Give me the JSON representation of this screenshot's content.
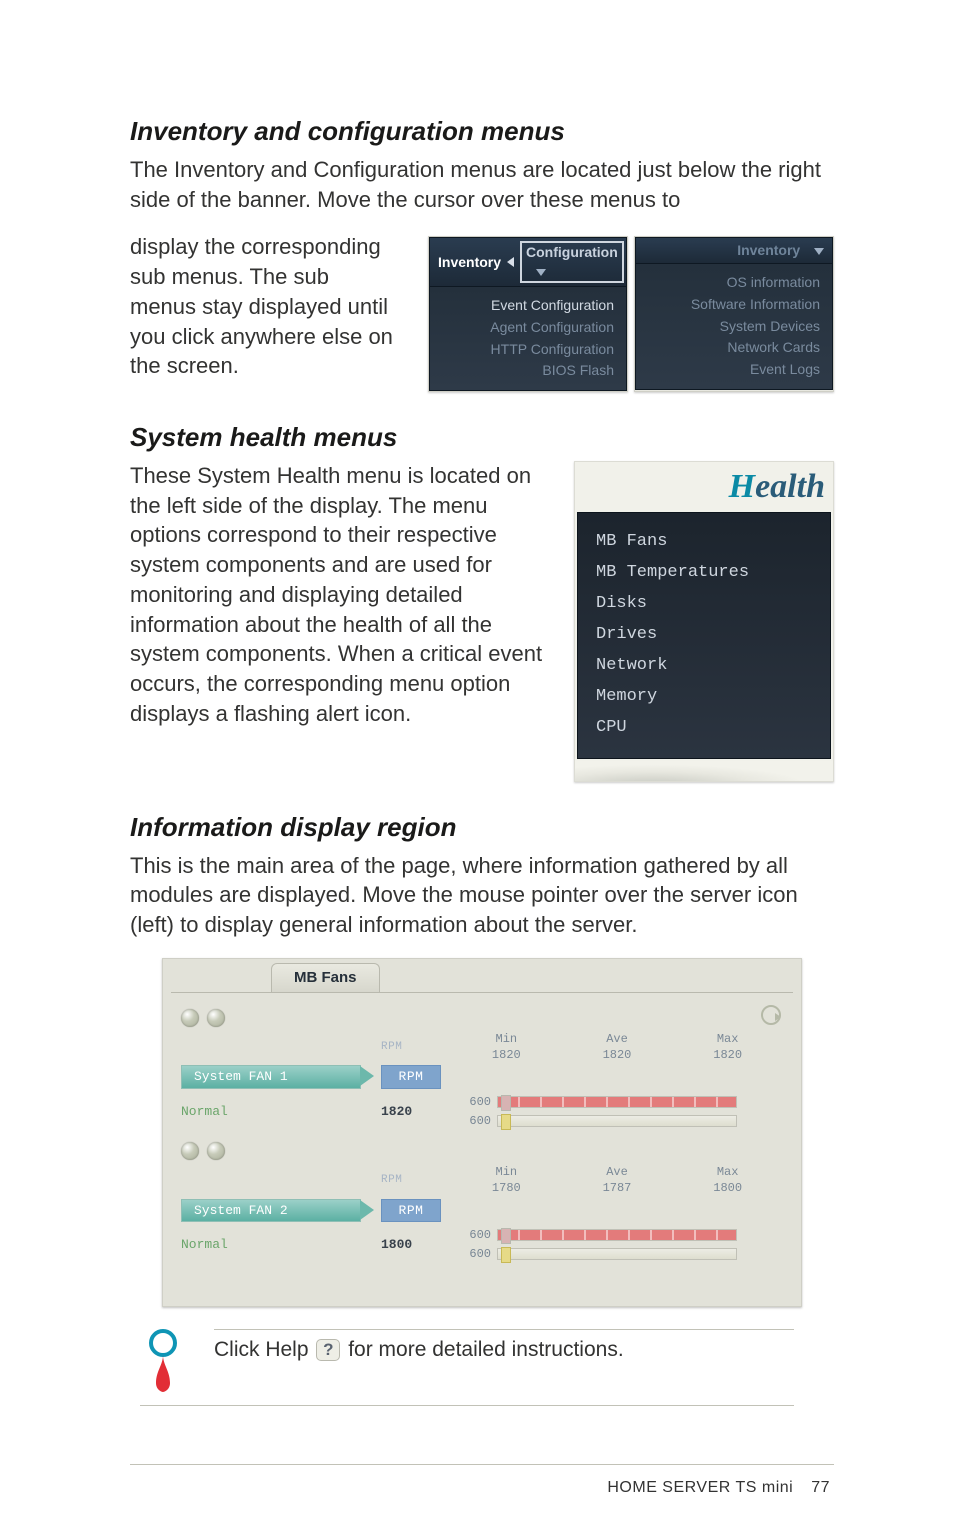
{
  "sections": {
    "invcfg": {
      "heading": "Inventory and configuration menus",
      "para_a": "The Inventory and Configuration menus are located just below the right side of the banner. Move the cursor over these menus to",
      "para_b": "display the corresponding sub menus. The sub menus stay displayed until you click anywhere else on the screen."
    },
    "syshealth": {
      "heading": "System health menus",
      "para": "These System Health menu is located on the left side of the display. The menu options correspond to their respective system components and are used for monitoring and displaying detailed information about the health of all the system components. When a critical event occurs, the corresponding menu option displays a flashing alert icon."
    },
    "inforegion": {
      "heading": "Information display region",
      "para": "This is the main area of the page, where information gathered by all modules are displayed. Move the mouse pointer over the server icon (left) to display general information about the server."
    }
  },
  "config_menu": {
    "header_left": "Inventory",
    "header_box": "Configuration",
    "items": [
      "Event Configuration",
      "Agent Configuration",
      "HTTP Configuration",
      "BIOS Flash"
    ]
  },
  "inventory_menu": {
    "header_right": "Inventory",
    "items": [
      "OS information",
      "Software Information",
      "System Devices",
      "Network Cards",
      "Event Logs"
    ]
  },
  "health_panel": {
    "title": "Health",
    "items": [
      "MB Fans",
      "MB Temperatures",
      "Disks",
      "Drives",
      "Network",
      "Memory",
      "CPU"
    ]
  },
  "mbfans": {
    "tab": "MB Fans",
    "cols": {
      "rpm": "RPM",
      "min": "Min",
      "ave": "Ave",
      "max": "Max"
    },
    "status": "Normal",
    "fans": [
      {
        "name": "System FAN 1",
        "rpm": "1820",
        "min": "1820",
        "ave": "1820",
        "max": "1820",
        "bar_a": "600",
        "bar_b": "600"
      },
      {
        "name": "System FAN 2",
        "rpm": "1800",
        "min": "1780",
        "ave": "1787",
        "max": "1800",
        "bar_a": "600",
        "bar_b": "600"
      }
    ]
  },
  "tip": {
    "text_a": "Click Help ",
    "text_b": " for more detailed instructions.",
    "help_glyph": "?"
  },
  "footer": {
    "label": "HOME SERVER TS mini",
    "page": "77"
  }
}
